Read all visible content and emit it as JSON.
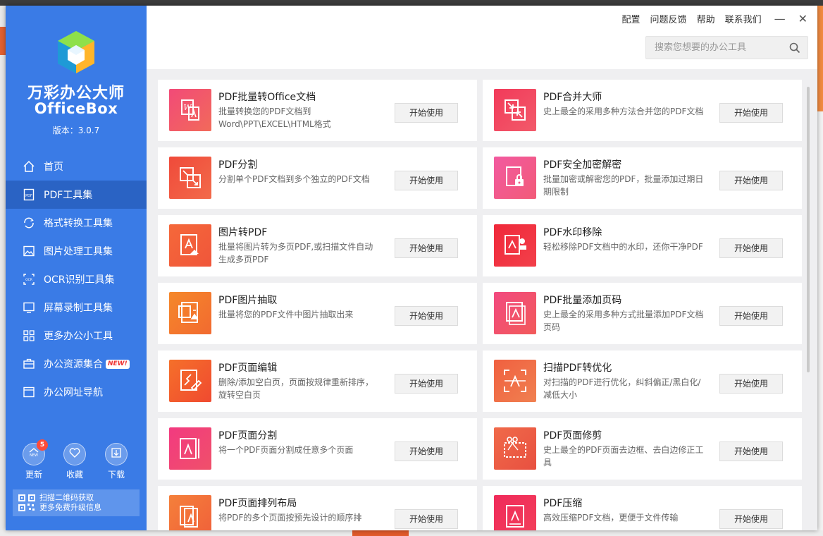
{
  "app": {
    "name_cn": "万彩办公大师",
    "name_en": "OfficeBox",
    "version": "版本：3.0.7"
  },
  "sidebar": {
    "items": [
      {
        "label": "首页",
        "icon": "home-icon"
      },
      {
        "label": "PDF工具集",
        "icon": "pdf-icon",
        "active": true
      },
      {
        "label": "格式转换工具集",
        "icon": "convert-icon"
      },
      {
        "label": "图片处理工具集",
        "icon": "image-icon"
      },
      {
        "label": "OCR识别工具集",
        "icon": "ocr-icon"
      },
      {
        "label": "屏幕录制工具集",
        "icon": "screen-icon"
      },
      {
        "label": "更多办公小工具",
        "icon": "grid-icon"
      },
      {
        "label": "办公资源集合",
        "icon": "briefcase-icon",
        "badge": "NEW!"
      },
      {
        "label": "办公网址导航",
        "icon": "browser-icon"
      }
    ],
    "quick": [
      {
        "label": "更新",
        "icon": "update-icon",
        "badge": "5"
      },
      {
        "label": "收藏",
        "icon": "heart-icon"
      },
      {
        "label": "下载",
        "icon": "download-icon"
      }
    ],
    "qr_text_1": "扫描二维码获取",
    "qr_text_2": "更多免费升级信息"
  },
  "topbar": {
    "menu": [
      "配置",
      "问题反馈",
      "帮助",
      "联系我们"
    ],
    "minimize": "—",
    "close": "✕",
    "search_placeholder": "搜索您想要的办公工具"
  },
  "cards": [
    {
      "title": "PDF批量转Office文档",
      "desc": "批量转换您的PDF文档到Word\\PPT\\EXCEL\\HTML格式",
      "button": "开始使用",
      "color1": "#f24a78",
      "color2": "#f26a5a"
    },
    {
      "title": "PDF合并大师",
      "desc": "史上最全的采用多种方法合并您的PDF文档",
      "button": "开始使用",
      "color1": "#f23a5a",
      "color2": "#f25a6a"
    },
    {
      "title": "PDF分割",
      "desc": "分割单个PDF文档到多个独立的PDF文档",
      "button": "开始使用",
      "color1": "#f04a3a",
      "color2": "#f26a4a"
    },
    {
      "title": "PDF安全加密解密",
      "desc": "批量加密或解密您的PDF，批量添加过期日期限制",
      "button": "开始使用",
      "color1": "#f25aa0",
      "color2": "#f25a78"
    },
    {
      "title": "图片转PDF",
      "desc": "批量将图片转为多页PDF,或扫描文件自动生成多页PDF",
      "button": "开始使用",
      "color1": "#f5683a",
      "color2": "#f0563a"
    },
    {
      "title": "PDF水印移除",
      "desc": "轻松移除PDF文档中的水印，还你干净PDF",
      "button": "开始使用",
      "color1": "#f0283a",
      "color2": "#f2404a"
    },
    {
      "title": "PDF图片抽取",
      "desc": "批量将您的PDF文件中图片抽取出来",
      "button": "开始使用",
      "color1": "#f5882a",
      "color2": "#f26a30"
    },
    {
      "title": "PDF批量添加页码",
      "desc": "史上最全的采用多种方式批量添加PDF文档页码",
      "button": "开始使用",
      "color1": "#f24a80",
      "color2": "#f25a5a"
    },
    {
      "title": "PDF页面编辑",
      "desc": "删除/添加空白页，页面按规律重新排序，旋转空白页",
      "button": "开始使用",
      "color1": "#f5702a",
      "color2": "#f04a30"
    },
    {
      "title": "扫描PDF转优化",
      "desc": "对扫描的PDF进行优化，纠斜偏正/黑白化/减低大小",
      "button": "开始使用",
      "color1": "#f06040",
      "color2": "#f08050"
    },
    {
      "title": "PDF页面分割",
      "desc": "将一个PDF页面分割成任意多个页面",
      "button": "开始使用",
      "color1": "#f23a80",
      "color2": "#f0506a"
    },
    {
      "title": "PDF页面修剪",
      "desc": "史上最全的PDF页面去边框、去白边修正工具",
      "button": "开始使用",
      "color1": "#f06a4a",
      "color2": "#e85040"
    },
    {
      "title": "PDF页面排列布局",
      "desc": "将PDF的多个页面按预先设计的顺序排",
      "button": "开始使用",
      "color1": "#f5803a",
      "color2": "#f0603a"
    },
    {
      "title": "PDF压缩",
      "desc": "高效压缩PDF文档，更便于文件传输",
      "button": "开始使用",
      "color1": "#f02a5a",
      "color2": "#f2405a"
    }
  ]
}
